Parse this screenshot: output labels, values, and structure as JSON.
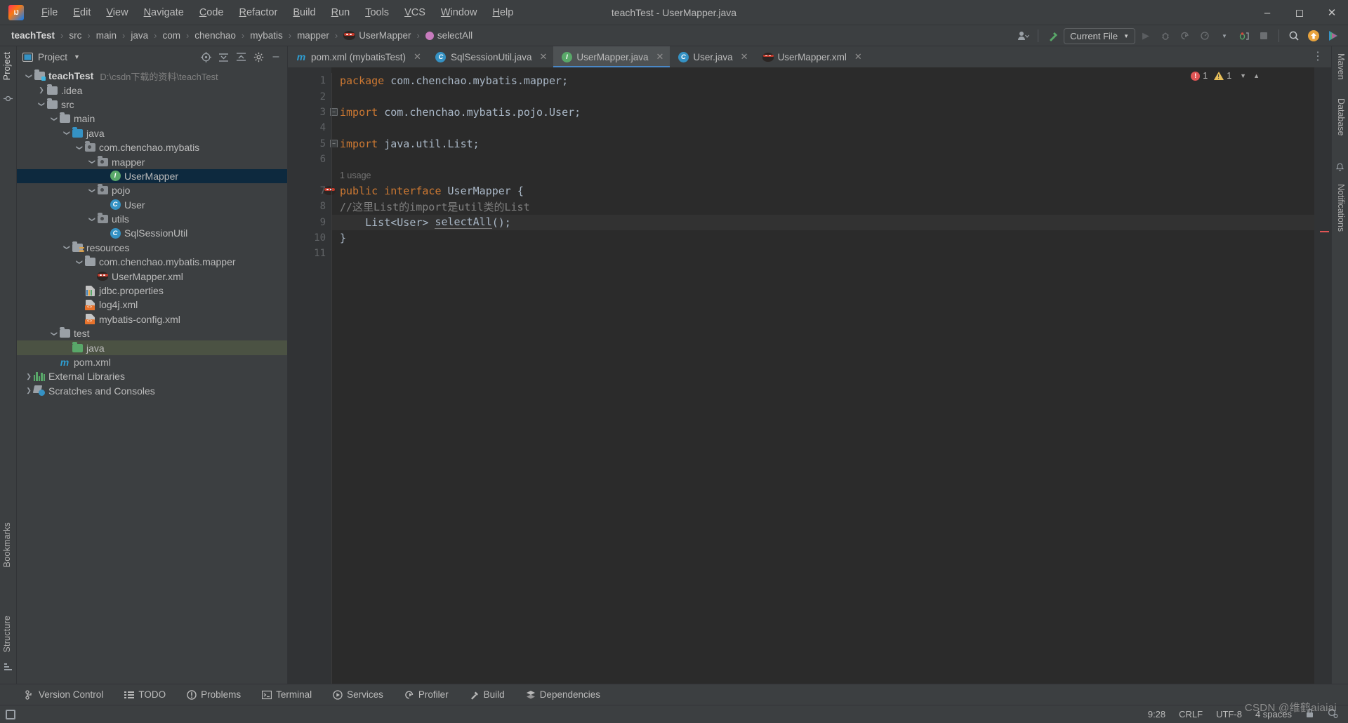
{
  "window": {
    "title": "teachTest - UserMapper.java",
    "logo_icon": "intellij-idea-logo",
    "minimize_icon": "minimize-icon",
    "maximize_icon": "maximize-icon",
    "close_icon": "close-icon"
  },
  "menu": [
    {
      "label": "File"
    },
    {
      "label": "Edit"
    },
    {
      "label": "View"
    },
    {
      "label": "Navigate"
    },
    {
      "label": "Code"
    },
    {
      "label": "Refactor"
    },
    {
      "label": "Build"
    },
    {
      "label": "Run"
    },
    {
      "label": "Tools"
    },
    {
      "label": "VCS"
    },
    {
      "label": "Window"
    },
    {
      "label": "Help"
    }
  ],
  "breadcrumbs": [
    {
      "label": "teachTest",
      "bold": true,
      "icon": null
    },
    {
      "label": "src",
      "bold": false,
      "icon": null
    },
    {
      "label": "main",
      "bold": false,
      "icon": null
    },
    {
      "label": "java",
      "bold": false,
      "icon": null
    },
    {
      "label": "com",
      "bold": false,
      "icon": null
    },
    {
      "label": "chenchao",
      "bold": false,
      "icon": null
    },
    {
      "label": "mybatis",
      "bold": false,
      "icon": null
    },
    {
      "label": "mapper",
      "bold": false,
      "icon": null
    },
    {
      "label": "UserMapper",
      "bold": false,
      "icon": "mybatis-ninja-icon"
    },
    {
      "label": "selectAll",
      "bold": false,
      "icon": "method-icon"
    }
  ],
  "toolbar": {
    "user_icon": "user-avatar-icon",
    "build_icon": "hammer-icon",
    "run_config": "Current File",
    "run_icon": "run-icon",
    "debug_icon": "debug-icon",
    "coverage_icon": "run-with-coverage-icon",
    "profile_icon": "profiler-icon",
    "more_icon": "chevron-down-icon",
    "attach_icon": "attach-debugger-icon",
    "stop_icon": "stop-icon",
    "search_icon": "search-everywhere-icon",
    "update_icon": "update-available-icon",
    "ai_icon": "ai-assistant-icon",
    "settings_icon": "settings-gear-icon"
  },
  "left_strip": {
    "tabs": [
      "Project",
      "Bookmarks",
      "Structure"
    ],
    "commit_icon": "commit-icon"
  },
  "right_strip": {
    "tabs": [
      "Maven",
      "Database",
      "Notifications"
    ],
    "bell_icon": "bell-icon"
  },
  "project_panel": {
    "title": "Project",
    "panel_icon": "project-view-icon",
    "dropdown_icon": "chevron-down-icon",
    "actions": [
      {
        "name": "select-opened-file-icon"
      },
      {
        "name": "expand-all-icon"
      },
      {
        "name": "collapse-all-icon"
      },
      {
        "name": "settings-gear-icon"
      },
      {
        "name": "hide-icon"
      }
    ],
    "tree": [
      {
        "label": "teachTest",
        "path": "D:\\csdn下载的资料\\teachTest",
        "indent": 0,
        "arrow": "down",
        "icon": "module-folder-icon",
        "bold": true,
        "state": "none"
      },
      {
        "label": ".idea",
        "indent": 1,
        "arrow": "right",
        "icon": "folder-icon",
        "state": "none"
      },
      {
        "label": "src",
        "indent": 1,
        "arrow": "down",
        "icon": "folder-icon",
        "state": "none"
      },
      {
        "label": "main",
        "indent": 2,
        "arrow": "down",
        "icon": "folder-icon",
        "state": "none"
      },
      {
        "label": "java",
        "indent": 3,
        "arrow": "down",
        "icon": "source-root-folder-icon",
        "state": "none"
      },
      {
        "label": "com.chenchao.mybatis",
        "indent": 4,
        "arrow": "down",
        "icon": "package-icon",
        "state": "none"
      },
      {
        "label": "mapper",
        "indent": 5,
        "arrow": "down",
        "icon": "package-icon",
        "state": "none"
      },
      {
        "label": "UserMapper",
        "indent": 6,
        "arrow": "none",
        "icon": "interface-icon",
        "state": "selected-blue"
      },
      {
        "label": "pojo",
        "indent": 5,
        "arrow": "down",
        "icon": "package-icon",
        "state": "none"
      },
      {
        "label": "User",
        "indent": 6,
        "arrow": "none",
        "icon": "class-icon",
        "state": "none"
      },
      {
        "label": "utils",
        "indent": 5,
        "arrow": "down",
        "icon": "package-icon",
        "state": "none"
      },
      {
        "label": "SqlSessionUtil",
        "indent": 6,
        "arrow": "none",
        "icon": "class-icon",
        "state": "none"
      },
      {
        "label": "resources",
        "indent": 3,
        "arrow": "down",
        "icon": "resources-folder-icon",
        "state": "none"
      },
      {
        "label": "com.chenchao.mybatis.mapper",
        "indent": 4,
        "arrow": "down",
        "icon": "folder-icon",
        "state": "none"
      },
      {
        "label": "UserMapper.xml",
        "indent": 5,
        "arrow": "none",
        "icon": "mybatis-ninja-icon",
        "state": "none"
      },
      {
        "label": "jdbc.properties",
        "indent": 4,
        "arrow": "none",
        "icon": "properties-file-icon",
        "state": "none"
      },
      {
        "label": "log4j.xml",
        "indent": 4,
        "arrow": "none",
        "icon": "xml-file-icon",
        "state": "none"
      },
      {
        "label": "mybatis-config.xml",
        "indent": 4,
        "arrow": "none",
        "icon": "xml-file-icon",
        "state": "none"
      },
      {
        "label": "test",
        "indent": 2,
        "arrow": "down",
        "icon": "folder-icon",
        "state": "none"
      },
      {
        "label": "java",
        "indent": 3,
        "arrow": "none",
        "icon": "test-source-folder-icon",
        "state": "selected-green"
      },
      {
        "label": "pom.xml",
        "indent": 2,
        "arrow": "none",
        "icon": "maven-icon",
        "state": "none"
      },
      {
        "label": "External Libraries",
        "indent": 0,
        "arrow": "right",
        "icon": "external-libraries-icon",
        "state": "none"
      },
      {
        "label": "Scratches and Consoles",
        "indent": 0,
        "arrow": "right",
        "icon": "scratches-icon",
        "state": "none"
      }
    ]
  },
  "editor": {
    "tabs": [
      {
        "label": "pom.xml (mybatisTest)",
        "icon": "maven-icon",
        "active": false
      },
      {
        "label": "SqlSessionUtil.java",
        "icon": "class-icon",
        "active": false
      },
      {
        "label": "UserMapper.java",
        "icon": "interface-icon",
        "active": true
      },
      {
        "label": "User.java",
        "icon": "class-icon",
        "active": false
      },
      {
        "label": "UserMapper.xml",
        "icon": "mybatis-ninja-icon",
        "active": false
      }
    ],
    "tab_close_icon": "close-icon",
    "tab_overflow_icon": "more-options-icon",
    "line_numbers": [
      "1",
      "2",
      "3",
      "4",
      "5",
      "6",
      "7",
      "8",
      "9",
      "10",
      "11"
    ],
    "usage_hint": {
      "line": 7,
      "text": "1 usage"
    },
    "lines": [
      {
        "num": 1,
        "tokens": [
          {
            "t": "package ",
            "c": "kw"
          },
          {
            "t": "com.chenchao.mybatis.mapper;",
            "c": "plain"
          }
        ]
      },
      {
        "num": 2,
        "tokens": []
      },
      {
        "num": 3,
        "fold": "collapse",
        "tokens": [
          {
            "t": "import ",
            "c": "kw"
          },
          {
            "t": "com.chenchao.mybatis.pojo.User;",
            "c": "plain"
          }
        ]
      },
      {
        "num": 4,
        "tokens": []
      },
      {
        "num": 5,
        "fold": "collapse-end",
        "tokens": [
          {
            "t": "import ",
            "c": "kw"
          },
          {
            "t": "java.util.List;",
            "c": "plain"
          }
        ]
      },
      {
        "num": 6,
        "tokens": []
      },
      {
        "num": 7,
        "gutter_icon": "mybatis-ninja-icon",
        "tokens": [
          {
            "t": "public interface ",
            "c": "kw"
          },
          {
            "t": "UserMapper ",
            "c": "cls"
          },
          {
            "t": "{",
            "c": "plain"
          }
        ]
      },
      {
        "num": 8,
        "tokens": [
          {
            "t": "//这里List的import是util类的List",
            "c": "cm"
          }
        ]
      },
      {
        "num": 9,
        "caret": true,
        "tokens": [
          {
            "t": "    List<User> ",
            "c": "plain"
          },
          {
            "t": "selectAll",
            "c": "mth"
          },
          {
            "t": "();",
            "c": "plain"
          }
        ]
      },
      {
        "num": 10,
        "tokens": [
          {
            "t": "}",
            "c": "plain"
          }
        ]
      },
      {
        "num": 11,
        "tokens": []
      }
    ],
    "inspections": {
      "errors": "1",
      "warnings": "1",
      "error_icon": "error-icon",
      "warning_icon": "warning-icon",
      "collapse_icon": "chevron-down-icon"
    }
  },
  "bottom_bar": [
    {
      "label": "Version Control",
      "icon": "branch-icon"
    },
    {
      "label": "TODO",
      "icon": "todo-list-icon"
    },
    {
      "label": "Problems",
      "icon": "problems-icon"
    },
    {
      "label": "Terminal",
      "icon": "terminal-icon"
    },
    {
      "label": "Services",
      "icon": "services-icon"
    },
    {
      "label": "Profiler",
      "icon": "profiler-icon"
    },
    {
      "label": "Build",
      "icon": "hammer-icon"
    },
    {
      "label": "Dependencies",
      "icon": "dependencies-icon"
    }
  ],
  "status_bar": {
    "layout_icon": "layout-icon",
    "caret_position": "9:28",
    "line_separator": "CRLF",
    "encoding": "UTF-8",
    "indent": "4 spaces",
    "lock_icon": "read-only-icon",
    "inspection_icon": "inspection-widget-icon"
  },
  "watermark": "CSDN @维鹤aiaiai",
  "colors": {
    "accent_blue": "#4a88c7",
    "editor_bg": "#2b2b2b",
    "panel_bg": "#3c3f41",
    "gutter_bg": "#313335",
    "selection_blue": "#0d293e",
    "selection_green": "#4b5243",
    "keyword_orange": "#cc7832",
    "text_grey": "#a9b7c6",
    "comment_grey": "#808080"
  }
}
